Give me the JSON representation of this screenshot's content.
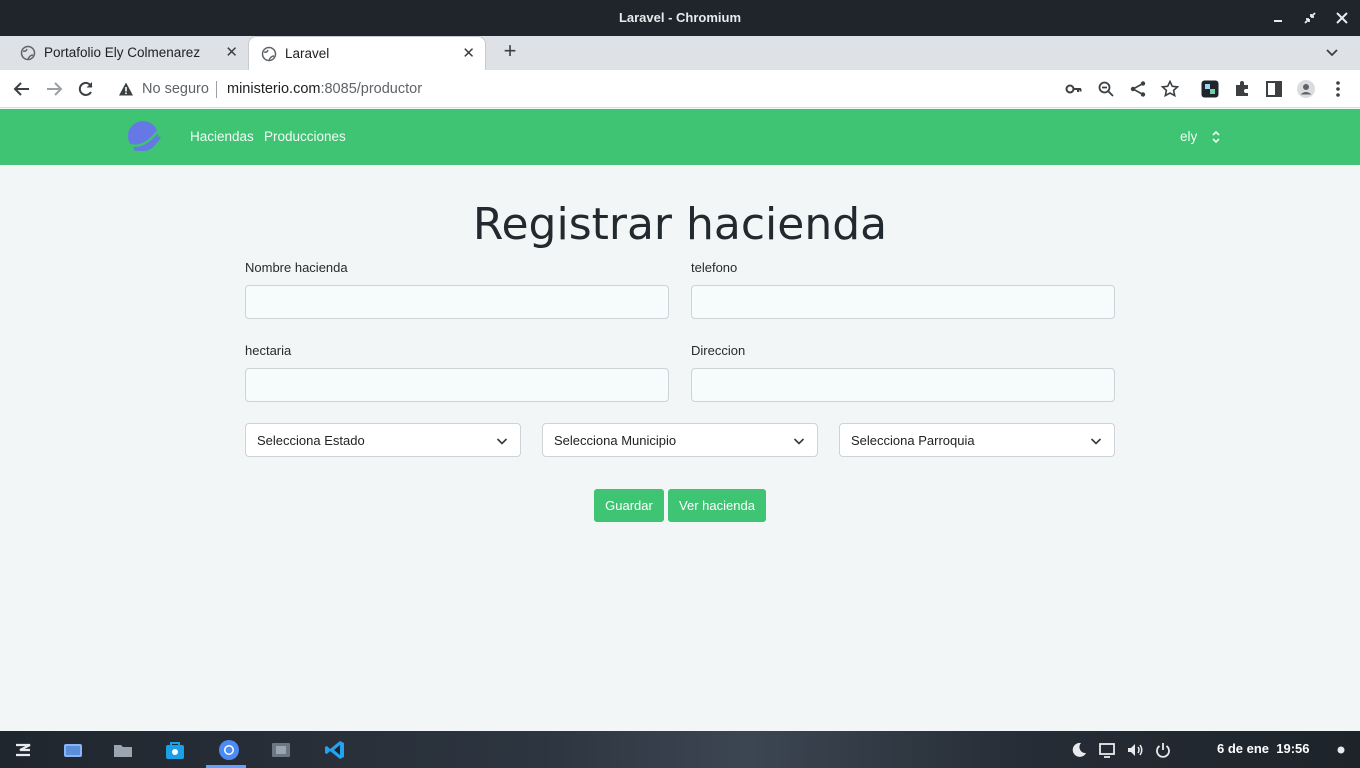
{
  "window": {
    "title": "Laravel - Chromium"
  },
  "tabs": [
    {
      "label": "Portafolio Ely Colmenarez",
      "active": false,
      "icon": "globe-icon"
    },
    {
      "label": "Laravel",
      "active": true,
      "icon": "globe-icon"
    }
  ],
  "omnibox": {
    "security": "No seguro",
    "host": "ministerio.com",
    "rest": ":8085/productor"
  },
  "navbar": {
    "links": [
      "Haciendas",
      "Producciones"
    ],
    "user": "ely",
    "brand_color": "#3ec472"
  },
  "form": {
    "heading": "Registrar hacienda",
    "fields": [
      {
        "label": "Nombre hacienda",
        "value": ""
      },
      {
        "label": "telefono",
        "value": ""
      },
      {
        "label": "hectaria",
        "value": ""
      },
      {
        "label": "Direccion",
        "value": ""
      }
    ],
    "selects": [
      {
        "selected": "Selecciona Estado"
      },
      {
        "selected": "Selecciona Municipio"
      },
      {
        "selected": "Selecciona Parroquia"
      }
    ],
    "buttons": {
      "save": "Guardar",
      "view": "Ver hacienda"
    }
  },
  "taskbar": {
    "date": "6 de ene",
    "time": "19:56"
  }
}
